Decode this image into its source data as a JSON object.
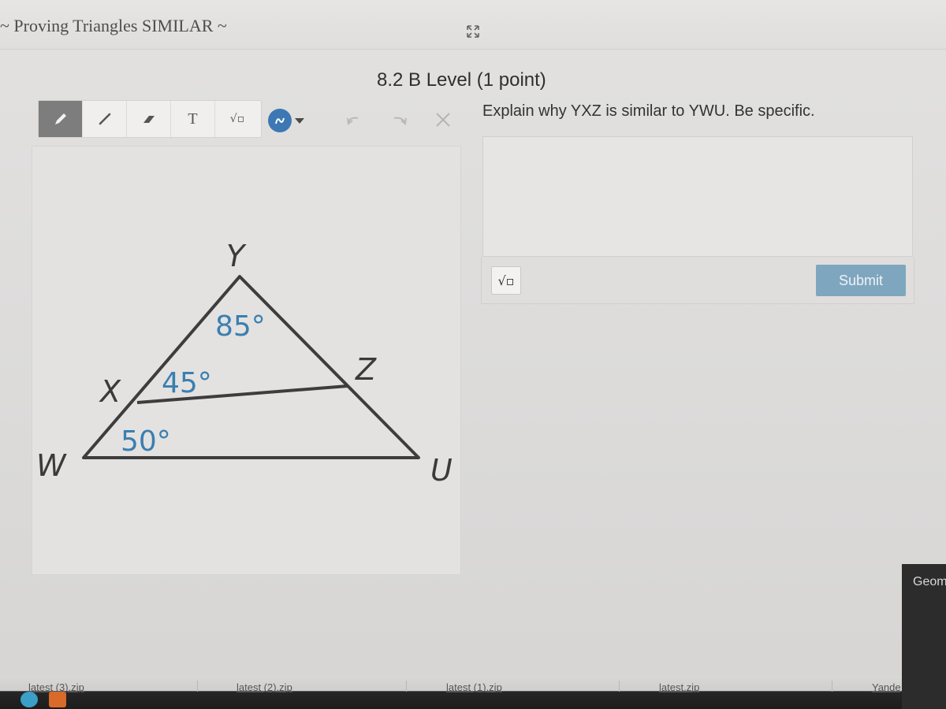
{
  "header": {
    "doc_title": "~ Proving Triangles SIMILAR ~"
  },
  "question": {
    "title": "8.2 B Level (1 point)",
    "prompt": "Explain why YXZ is similar to YWU. Be specific."
  },
  "toolbar": {
    "tools": [
      {
        "name": "pencil-icon"
      },
      {
        "name": "line-icon"
      },
      {
        "name": "eraser-icon"
      },
      {
        "name": "text-tool",
        "label": "T"
      },
      {
        "name": "sqrt-icon",
        "label": "√▫"
      }
    ],
    "color": "#3d78b4",
    "undo_icon": "undo-icon",
    "redo_icon": "redo-icon",
    "clear_icon": "clear-icon"
  },
  "figure": {
    "vertices": {
      "Y": "Y",
      "X": "X",
      "Z": "Z",
      "W": "W",
      "U": "U"
    },
    "angles": {
      "y": "85°",
      "x": "45°",
      "w": "50°"
    },
    "angle_color": "#3a7fb0"
  },
  "answer": {
    "value": "",
    "placeholder": "",
    "sqrt_label": "√▫",
    "submit_label": "Submit"
  },
  "side_tab": {
    "label": "Geom"
  },
  "downloads": {
    "items": [
      "latest (3).zip",
      "latest (2).zip",
      "latest (1).zip",
      "latest.zip",
      "Yande"
    ]
  }
}
